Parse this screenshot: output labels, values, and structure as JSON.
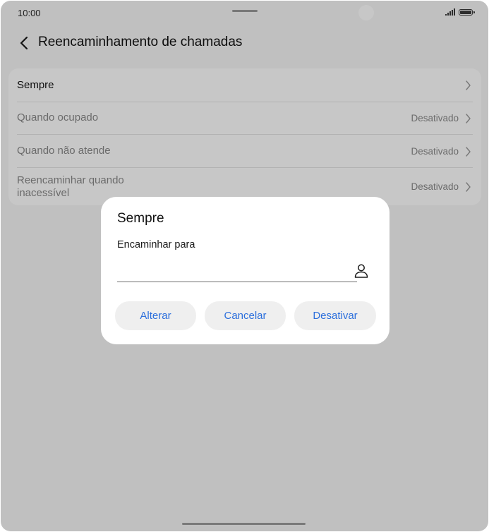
{
  "status_bar": {
    "time": "10:00",
    "icons": [
      "signal-icon",
      "battery-icon"
    ]
  },
  "header": {
    "title": "Reencaminhamento de chamadas",
    "back_icon": "chevron-left-icon"
  },
  "settings": [
    {
      "label": "Sempre",
      "value": ""
    },
    {
      "label": "Quando ocupado",
      "value": "Desativado"
    },
    {
      "label": "Quando não atende",
      "value": "Desativado"
    },
    {
      "label": "Reencaminhar quando inacessível",
      "label_line1": "Reencaminhar quando",
      "label_line2": "inacessível",
      "value": "Desativado"
    }
  ],
  "dialog": {
    "title": "Sempre",
    "field_label": "Encaminhar para",
    "field_value": "",
    "contact_icon": "person-icon",
    "buttons": {
      "change": "Alterar",
      "cancel": "Cancelar",
      "disable": "Desativar"
    }
  },
  "colors": {
    "accent": "#2c6fdc",
    "scrim": "rgba(0,0,0,0.22)",
    "muted_text": "#8a8a8a"
  }
}
